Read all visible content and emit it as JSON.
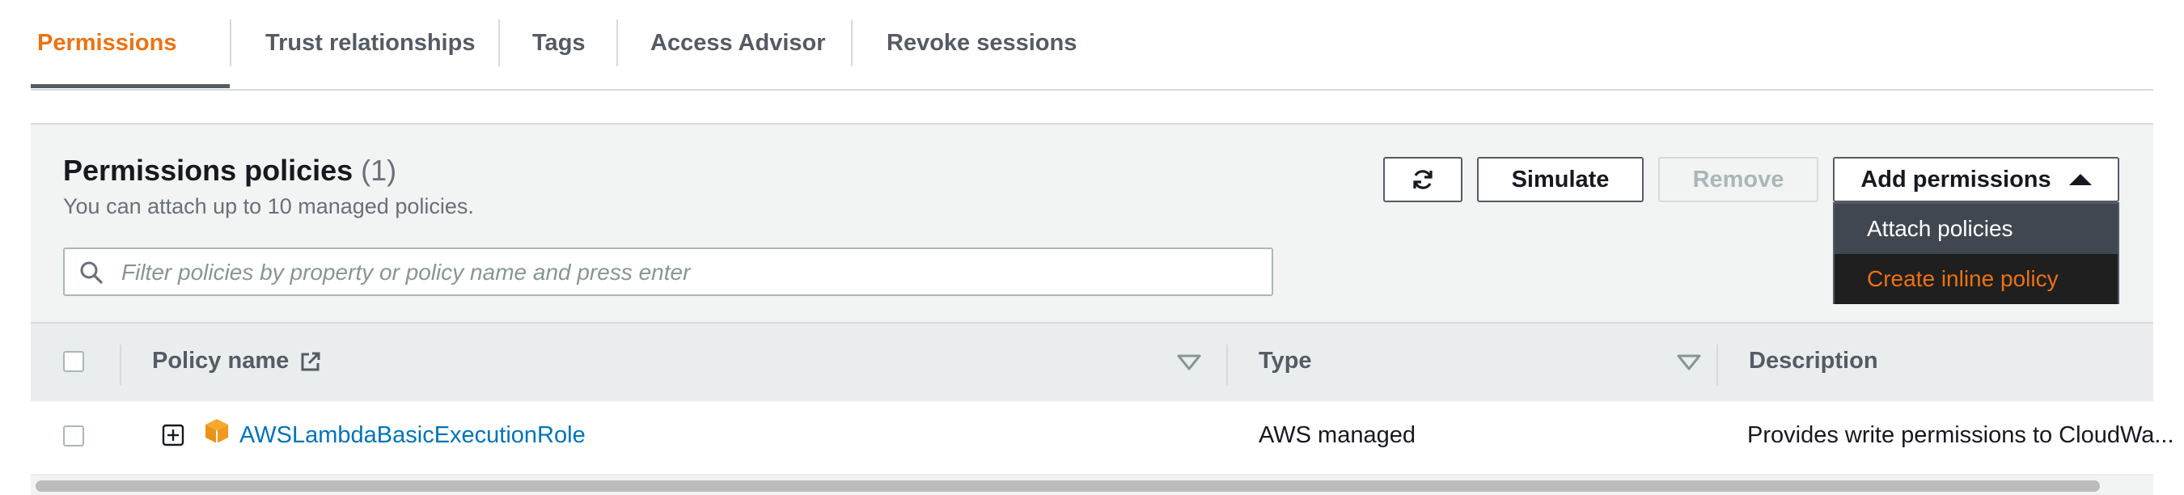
{
  "tabs": [
    {
      "label": "Permissions"
    },
    {
      "label": "Trust relationships"
    },
    {
      "label": "Tags"
    },
    {
      "label": "Access Advisor"
    },
    {
      "label": "Revoke sessions"
    }
  ],
  "panel": {
    "title": "Permissions policies",
    "count": "(1)",
    "subtitle": "You can attach up to 10 managed policies.",
    "buttons": {
      "simulate": "Simulate",
      "remove": "Remove",
      "add_permissions": "Add permissions"
    },
    "dropdown": {
      "items": [
        {
          "label": "Attach policies"
        },
        {
          "label": "Create inline policy"
        }
      ]
    },
    "search": {
      "placeholder": "Filter policies by property or policy name and press enter"
    }
  },
  "table": {
    "headers": {
      "policy_name": "Policy name",
      "type": "Type",
      "description": "Description"
    },
    "rows": [
      {
        "policy_name": "AWSLambdaBasicExecutionRole",
        "type": "AWS managed",
        "description": "Provides write permissions to CloudWa..."
      }
    ]
  },
  "colors": {
    "accent_orange": "#ec7211",
    "link_blue": "#0073bb",
    "text_dark": "#16191f",
    "text_gray": "#545b64"
  },
  "icons": [
    "refresh-icon",
    "caret-up-icon",
    "search-icon",
    "external-link-icon",
    "sort-icon",
    "expand-icon",
    "policy-cube-icon"
  ]
}
